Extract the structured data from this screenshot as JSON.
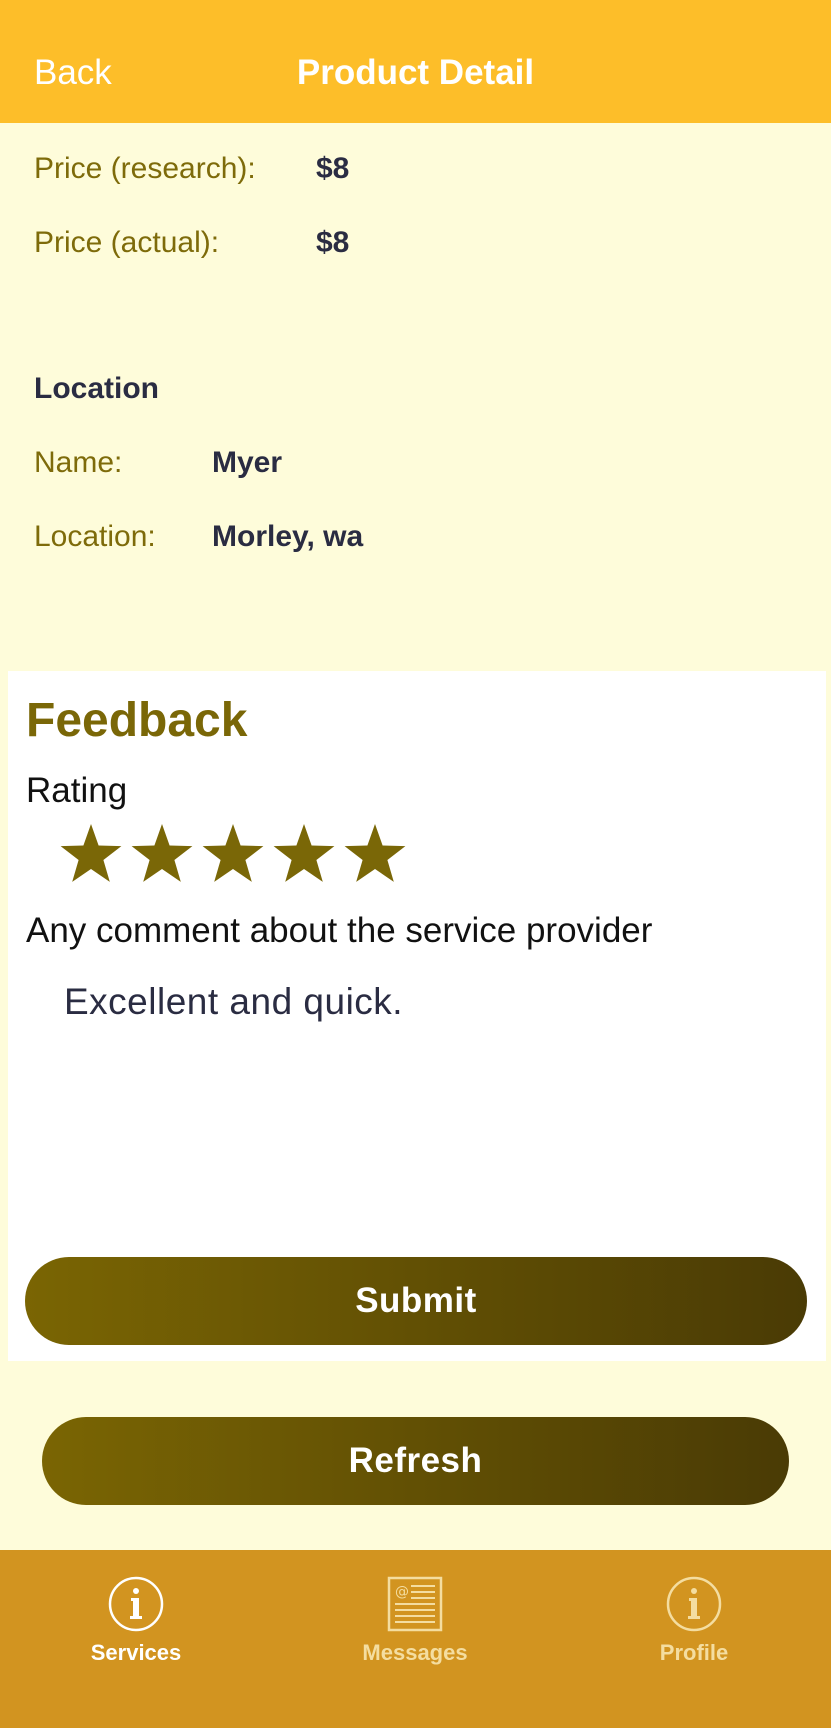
{
  "header": {
    "back_label": "Back",
    "title": "Product Detail"
  },
  "prices": {
    "research_label": "Price (research):",
    "research_value": "$8",
    "actual_label": "Price (actual):",
    "actual_value": "$8"
  },
  "location": {
    "section_title": "Location",
    "name_label": "Name:",
    "name_value": "Myer",
    "location_label": "Location:",
    "location_value": "Morley, wa"
  },
  "feedback": {
    "title": "Feedback",
    "rating_label": "Rating",
    "rating_value": 5,
    "rating_max": 5,
    "comment_label": "Any comment about the service provider",
    "comment_value": "Excellent and quick.",
    "submit_label": "Submit"
  },
  "refresh_label": "Refresh",
  "tabs": [
    {
      "label": "Services",
      "icon": "info-icon",
      "active": true
    },
    {
      "label": "Messages",
      "icon": "messages-icon",
      "active": false
    },
    {
      "label": "Profile",
      "icon": "info-icon",
      "active": false
    }
  ],
  "colors": {
    "header": "#FDBE29",
    "background": "#FEFCDA",
    "accent": "#7A6707",
    "tabbar": "#D29420"
  }
}
